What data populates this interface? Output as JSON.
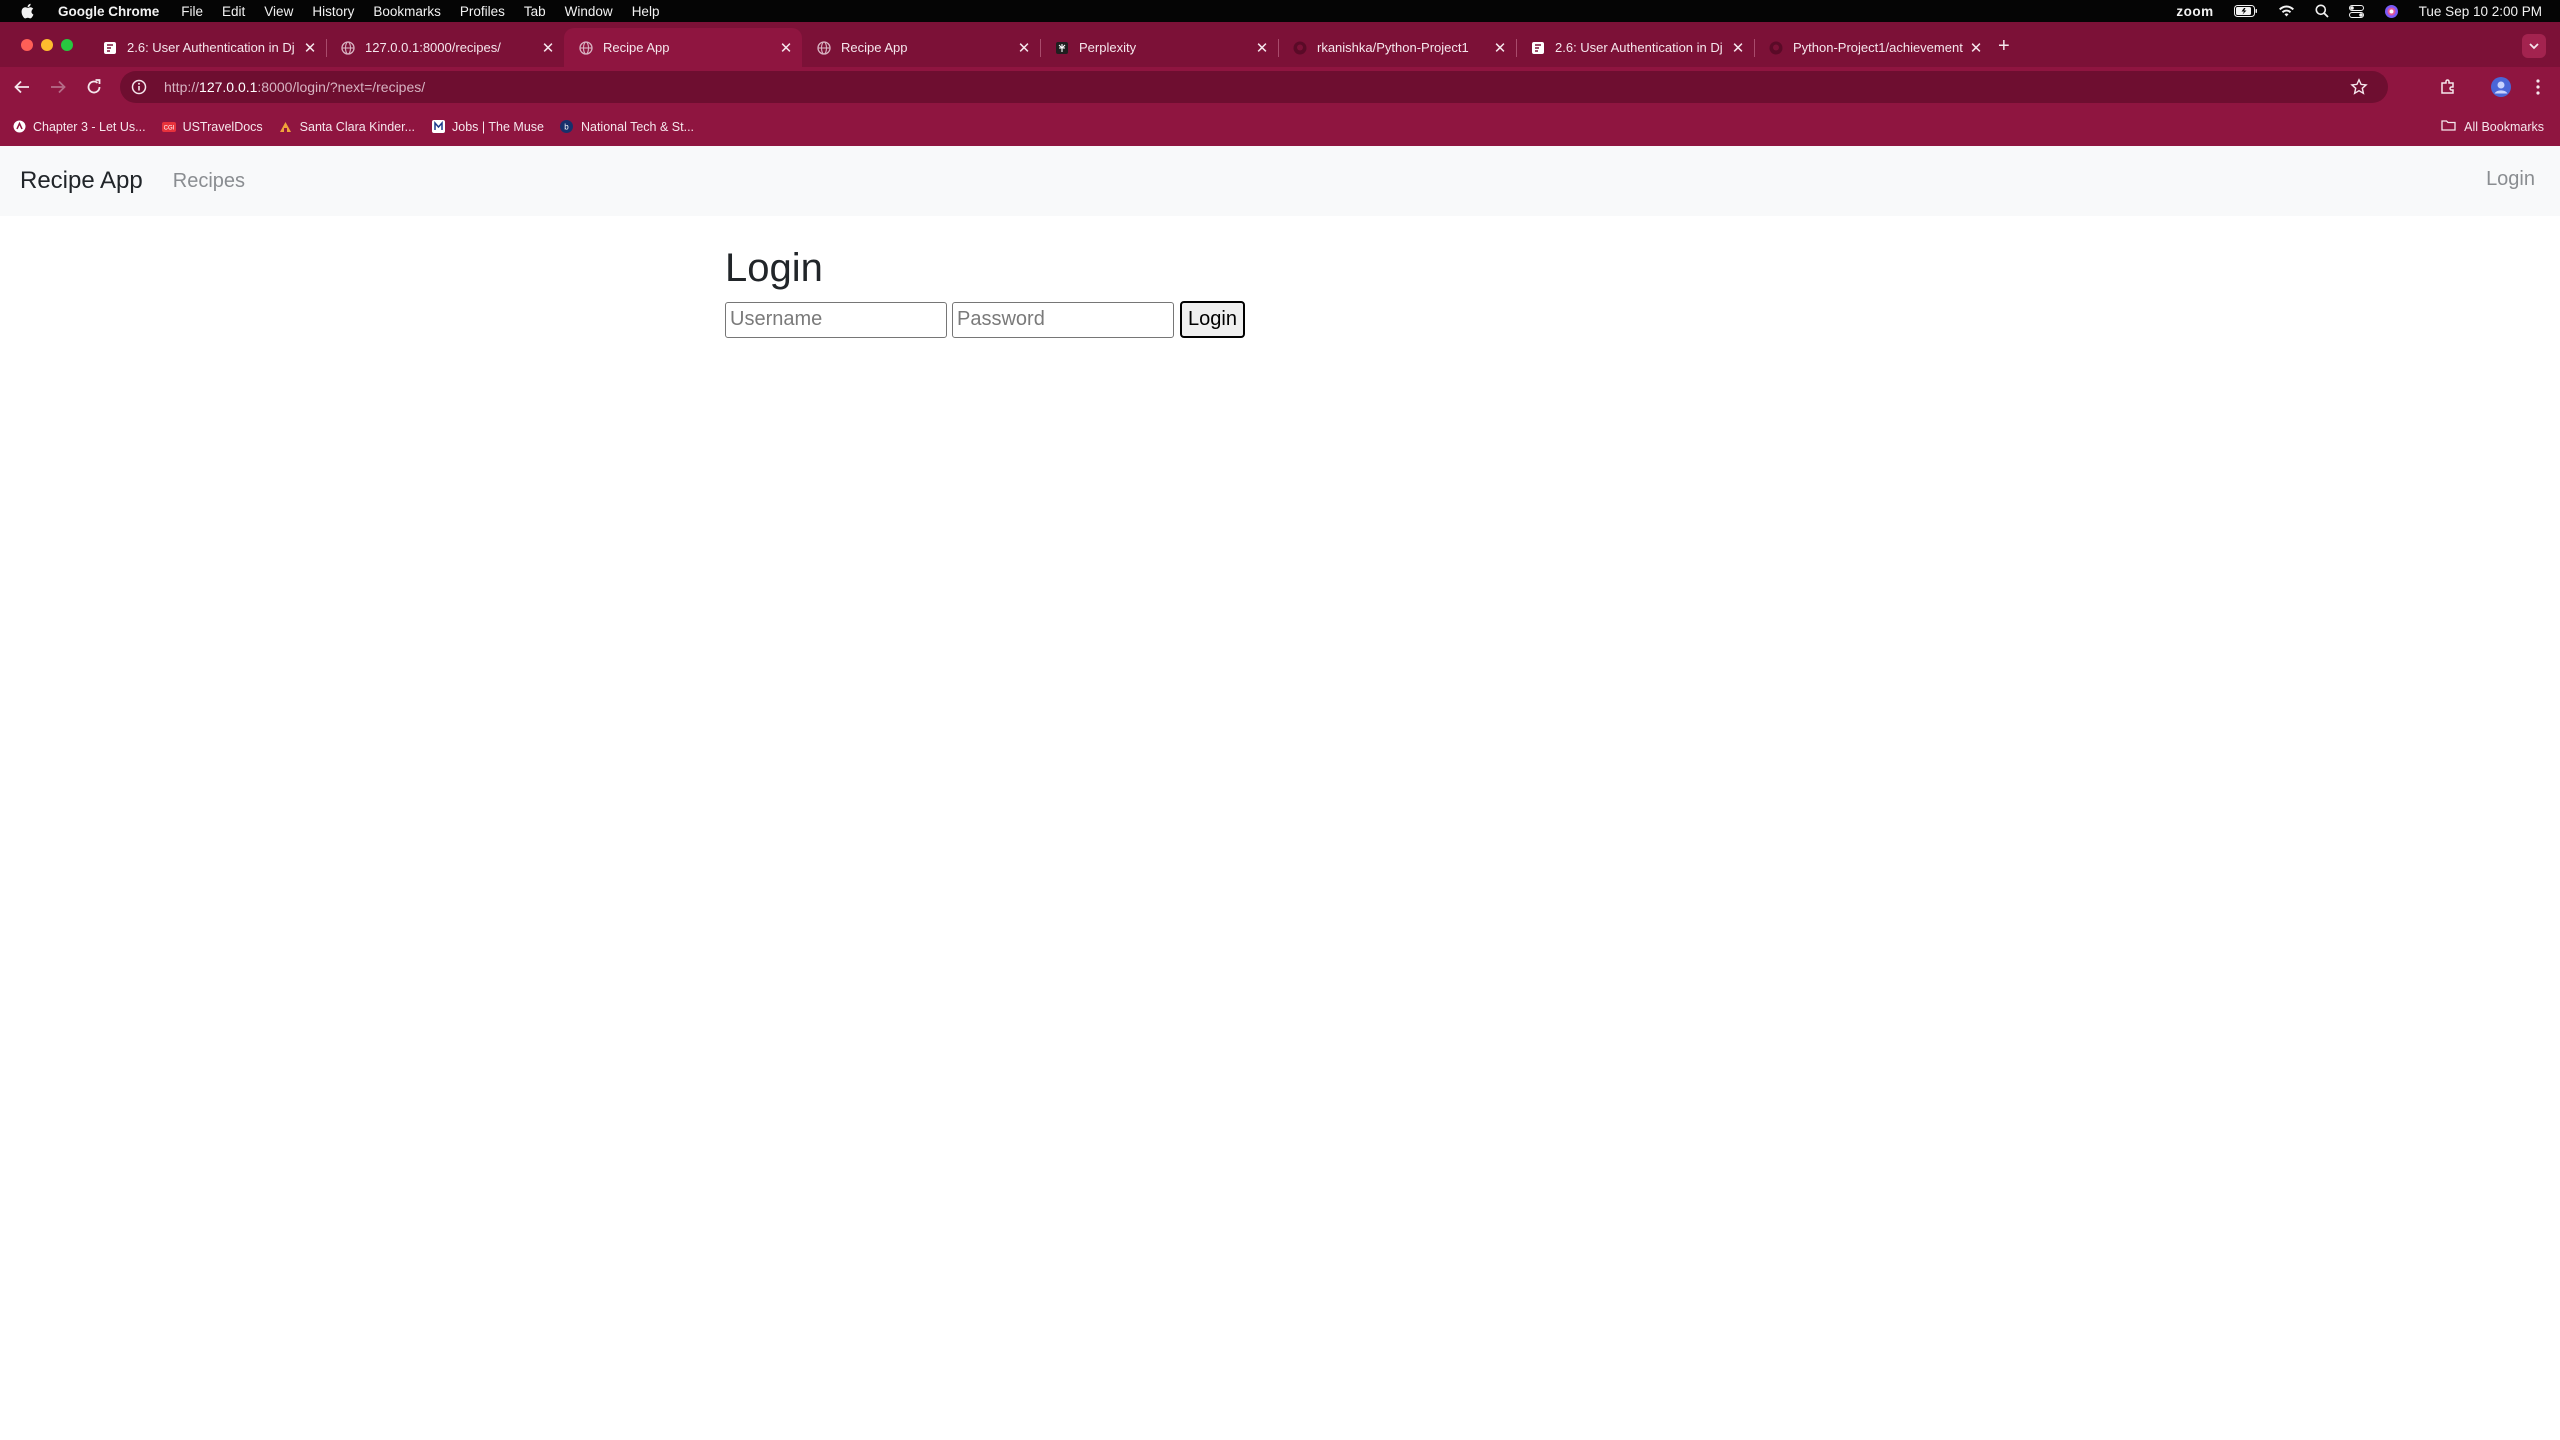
{
  "menubar": {
    "app": "Google Chrome",
    "items": [
      "File",
      "Edit",
      "View",
      "History",
      "Bookmarks",
      "Profiles",
      "Tab",
      "Window",
      "Help"
    ],
    "zoom": "zoom",
    "datetime": "Tue Sep 10  2:00 PM"
  },
  "tabs": [
    {
      "title": "2.6: User Authentication in Dj",
      "icon": "doc-icon"
    },
    {
      "title": "127.0.0.1:8000/recipes/",
      "icon": "globe-icon"
    },
    {
      "title": "Recipe App",
      "icon": "globe-icon",
      "active": true
    },
    {
      "title": "Recipe App",
      "icon": "globe-icon"
    },
    {
      "title": "Perplexity",
      "icon": "perplexity-icon"
    },
    {
      "title": "rkanishka/Python-Project1",
      "icon": "github-icon"
    },
    {
      "title": "2.6: User Authentication in Dj",
      "icon": "doc-icon"
    },
    {
      "title": "Python-Project1/achievement",
      "icon": "github-icon"
    }
  ],
  "address": {
    "prefix": "http://",
    "host": "127.0.0.1",
    "rest": ":8000/login/?next=/recipes/"
  },
  "bookmarks": [
    {
      "label": "Chapter 3 - Let Us...",
      "icon": "chapter-icon"
    },
    {
      "label": "USTravelDocs",
      "icon": "travel-icon"
    },
    {
      "label": "Santa Clara Kinder...",
      "icon": "school-icon"
    },
    {
      "label": "Jobs | The Muse",
      "icon": "muse-icon"
    },
    {
      "label": "National Tech & St...",
      "icon": "nts-icon"
    }
  ],
  "all_bookmarks": "All Bookmarks",
  "site": {
    "brand": "Recipe App",
    "nav_recipes": "Recipes",
    "nav_login": "Login"
  },
  "login": {
    "heading": "Login",
    "username_placeholder": "Username",
    "password_placeholder": "Password",
    "button": "Login"
  },
  "colors": {
    "chrome_theme": "#8f1540",
    "tabstrip": "#7c1137"
  }
}
